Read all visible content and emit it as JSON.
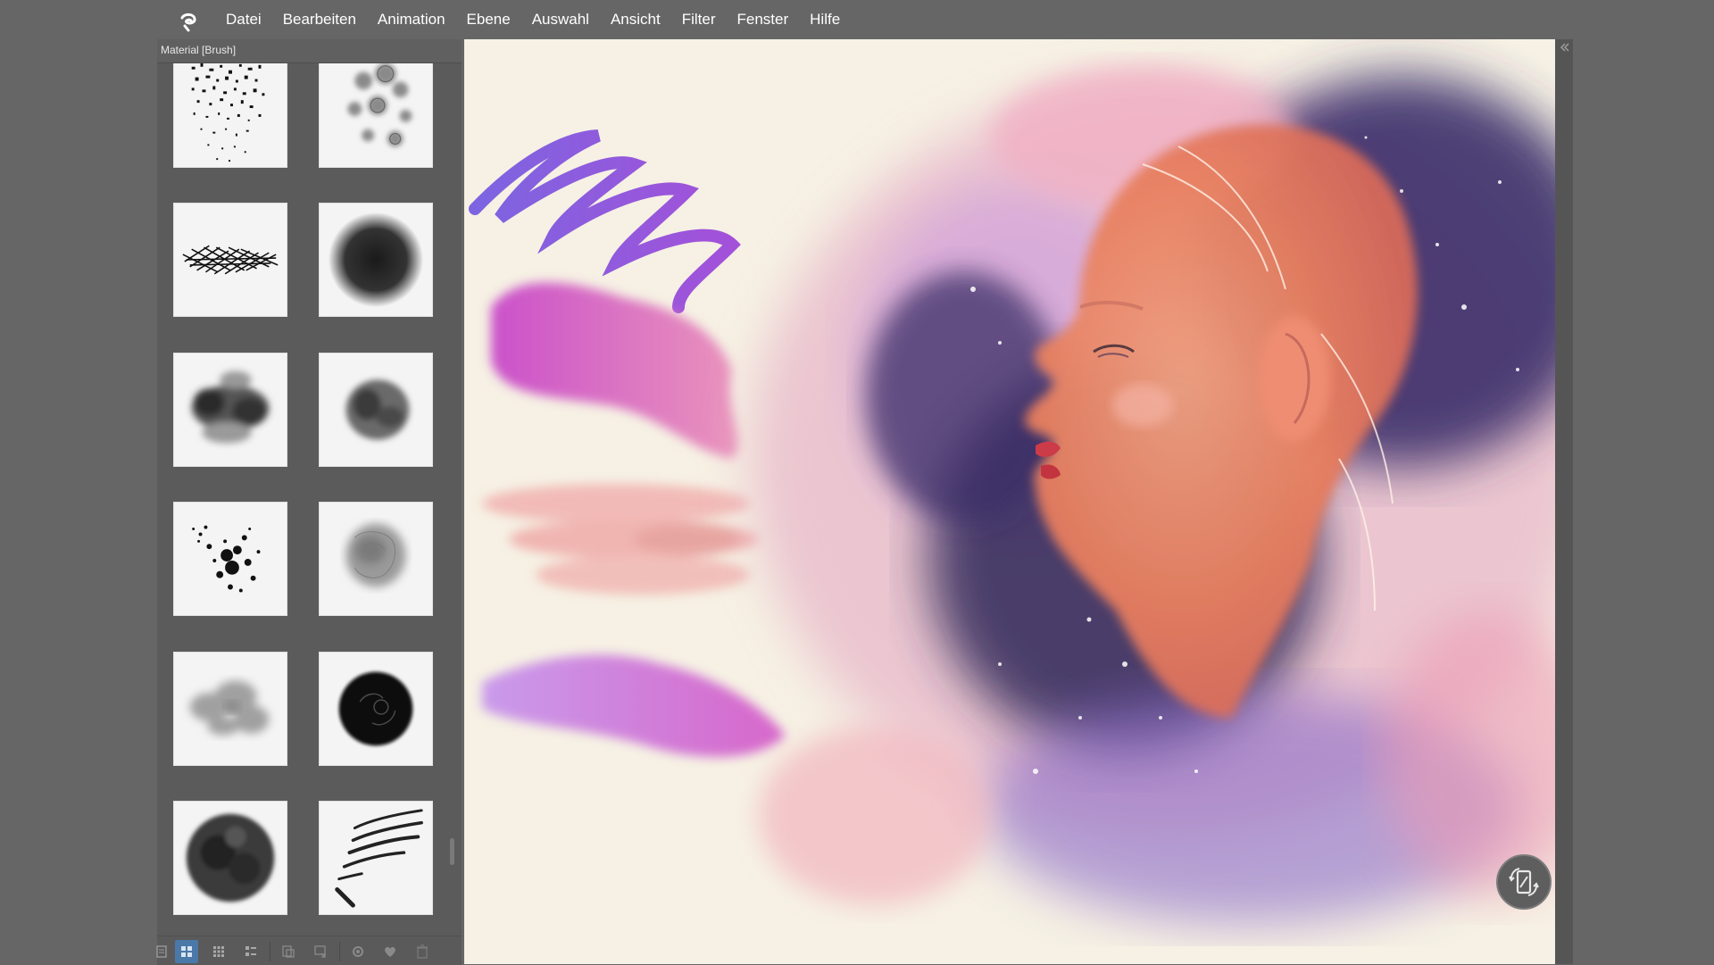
{
  "menu": {
    "items": [
      {
        "label": "Datei"
      },
      {
        "label": "Bearbeiten"
      },
      {
        "label": "Animation"
      },
      {
        "label": "Ebene"
      },
      {
        "label": "Auswahl"
      },
      {
        "label": "Ansicht"
      },
      {
        "label": "Filter"
      },
      {
        "label": "Fenster"
      },
      {
        "label": "Hilfe"
      }
    ]
  },
  "panel": {
    "title": "Material [Brush]",
    "thumbnails": [
      {
        "icon": "dots-noise-brush-icon"
      },
      {
        "icon": "blob-scatter-brush-icon"
      },
      {
        "icon": "crosshatch-brush-icon"
      },
      {
        "icon": "soft-round-brush-icon"
      },
      {
        "icon": "watercolor-splash-brush-icon"
      },
      {
        "icon": "wet-blot-brush-icon"
      },
      {
        "icon": "ink-splatter-brush-icon"
      },
      {
        "icon": "bleed-cloud-brush-icon"
      },
      {
        "icon": "cloud-wash-brush-icon"
      },
      {
        "icon": "dark-sphere-brush-icon"
      },
      {
        "icon": "sponge-blot-brush-icon"
      },
      {
        "icon": "diagonal-strokes-brush-icon"
      }
    ],
    "toolbar": [
      {
        "icon": "list-view-icon"
      },
      {
        "icon": "large-grid-view-icon",
        "active": true
      },
      {
        "icon": "small-grid-view-icon"
      },
      {
        "icon": "detail-list-view-icon"
      },
      {
        "icon": "paste-to-palette-icon"
      },
      {
        "icon": "import-material-icon"
      },
      {
        "icon": "settings-icon"
      },
      {
        "icon": "favorite-heart-icon"
      },
      {
        "icon": "trash-icon"
      }
    ]
  },
  "colors": {
    "background": "#666666",
    "panel": "#5b5b5b",
    "canvas_paper": "#f6f1e4",
    "accent_active": "#4a78a8"
  }
}
